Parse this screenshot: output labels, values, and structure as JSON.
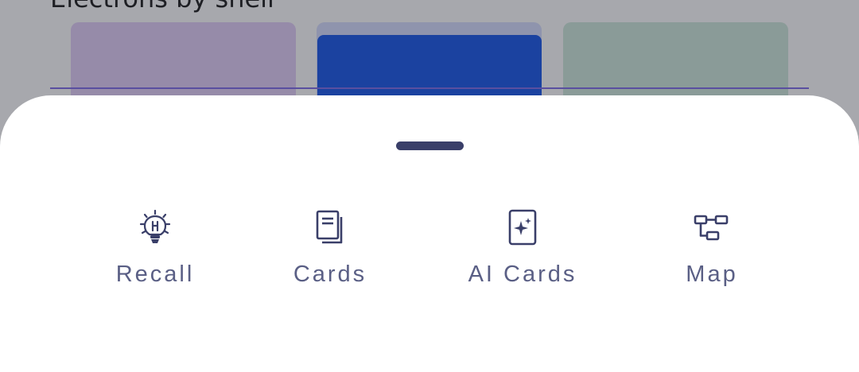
{
  "background": {
    "section_title": "Electrons by shell"
  },
  "sheet": {
    "actions": [
      {
        "label": "Recall",
        "icon": "lightbulb-icon"
      },
      {
        "label": "Cards",
        "icon": "cards-icon"
      },
      {
        "label": "AI Cards",
        "icon": "ai-sparkle-card-icon"
      },
      {
        "label": "Map",
        "icon": "mind-map-icon"
      }
    ]
  },
  "colors": {
    "icon": "#3a3f69",
    "label": "#5a5f85",
    "scrim": "#a7a8ad",
    "active_shell": "#1b42a0"
  }
}
